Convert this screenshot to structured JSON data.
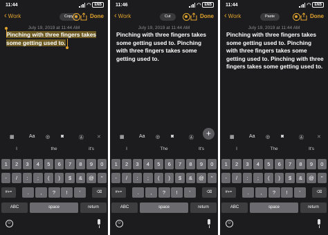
{
  "colors": {
    "accent": "#e3a52f",
    "background": "#1c1c1e",
    "highlight": "#6d5a22",
    "key": "#6b6b6f",
    "key_dark": "#3e3e41"
  },
  "icons": [
    "signal-icon",
    "wifi-icon",
    "battery-icon",
    "chevron-left-icon",
    "add-person-icon",
    "share-icon",
    "table-icon",
    "checklist-icon",
    "camera-icon",
    "markup-icon",
    "close-icon",
    "plus-icon",
    "emoji-icon",
    "microphone-icon"
  ],
  "panels": [
    {
      "status": {
        "time": "11:44",
        "battery": "ENB"
      },
      "back_label": "Work",
      "action_pill": "Copy",
      "done_label": "Done",
      "date": "July 19, 2019 at 11:44 AM",
      "note_text": "Pinching with three fingers takes some getting used to.",
      "toolbar": {
        "format_label": "Aa"
      },
      "suggestions": [
        "I",
        "the",
        "it's"
      ],
      "keys": {
        "row1": [
          "1",
          "2",
          "3",
          "4",
          "5",
          "6",
          "7",
          "8",
          "9",
          "0"
        ],
        "row2": [
          "-",
          "/",
          ":",
          ";",
          "(",
          ")",
          "$",
          "&",
          "@",
          "\""
        ],
        "row3": [
          "#+=",
          ".",
          ",",
          "?",
          "!",
          "'"
        ],
        "abc": "ABC",
        "space": "space",
        "return": "return"
      }
    },
    {
      "status": {
        "time": "11:46",
        "battery": "ENB"
      },
      "back_label": "Work",
      "action_pill": "Cut",
      "done_label": "Done",
      "date": "July 19, 2019 at 11:44 AM",
      "note_text": "Pinching with three fingers takes some getting used to. Pinching with three fingers takes some getting used to.",
      "toolbar": {
        "format_label": "Aa"
      },
      "fab_label": "+",
      "suggestions": [
        "I",
        "The",
        "It's"
      ],
      "keys": {
        "row1": [
          "1",
          "2",
          "3",
          "4",
          "5",
          "6",
          "7",
          "8",
          "9",
          "0"
        ],
        "row2": [
          "-",
          "/",
          ":",
          ";",
          "(",
          ")",
          "$",
          "&",
          "@",
          "\""
        ],
        "row3": [
          "#+=",
          ".",
          ",",
          "?",
          "!",
          "'"
        ],
        "abc": "ABC",
        "space": "space",
        "return": "return"
      }
    },
    {
      "status": {
        "time": "11:44",
        "battery": "ENB"
      },
      "back_label": "Work",
      "action_pill": "Paste",
      "done_label": "Done",
      "date": "July 19, 2019 at 11:44 AM",
      "note_text": "Pinching with three fingers takes some getting used to. Pinching with three fingers takes some getting used to. Pinching with three fingers takes some getting used to.",
      "toolbar": {
        "format_label": "Aa"
      },
      "suggestions": [
        "I",
        "The",
        "It's"
      ],
      "keys": {
        "row1": [
          "1",
          "2",
          "3",
          "4",
          "5",
          "6",
          "7",
          "8",
          "9",
          "0"
        ],
        "row2": [
          "-",
          "/",
          ":",
          ";",
          "(",
          ")",
          "$",
          "&",
          "@",
          "\""
        ],
        "row3": [
          "#+=",
          ".",
          ",",
          "?",
          "!",
          "'"
        ],
        "abc": "ABC",
        "space": "space",
        "return": "return"
      }
    }
  ]
}
